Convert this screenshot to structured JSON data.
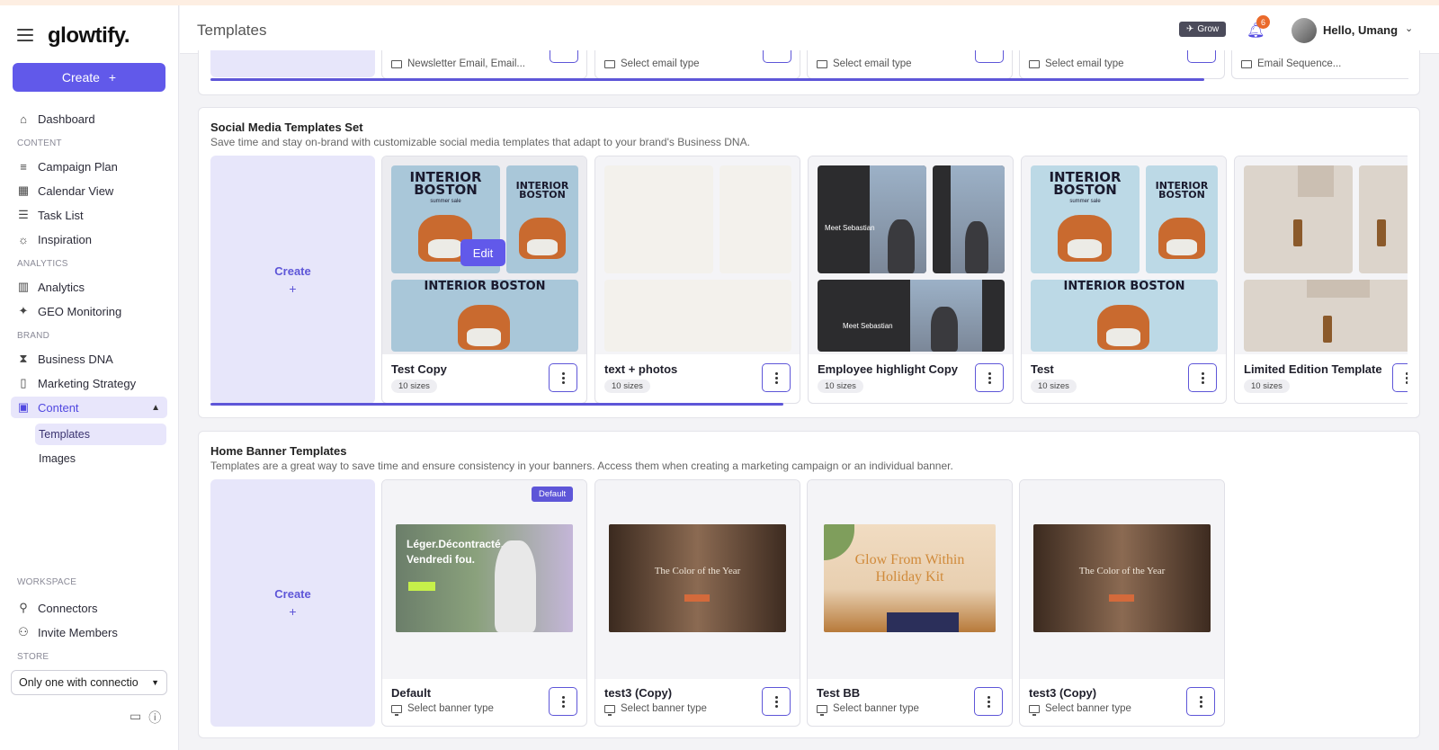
{
  "app": {
    "logo": "glowtify.",
    "page_title": "Templates"
  },
  "sidebar": {
    "create_label": "Create",
    "items": [
      {
        "label": "Dashboard",
        "icon": "home-icon"
      },
      {
        "label": "Campaign Plan",
        "icon": "lines-icon"
      },
      {
        "label": "Calendar View",
        "icon": "calendar-icon"
      },
      {
        "label": "Task List",
        "icon": "list-icon"
      },
      {
        "label": "Inspiration",
        "icon": "bulb-icon"
      },
      {
        "label": "Analytics",
        "icon": "bar-chart-icon"
      },
      {
        "label": "GEO Monitoring",
        "icon": "sparkle-icon"
      },
      {
        "label": "Business DNA",
        "icon": "dna-icon"
      },
      {
        "label": "Marketing Strategy",
        "icon": "book-icon"
      },
      {
        "label": "Content",
        "icon": "image-icon"
      },
      {
        "label": "Connectors",
        "icon": "plug-icon"
      },
      {
        "label": "Invite Members",
        "icon": "user-plus-icon"
      }
    ],
    "sections": {
      "content": "CONTENT",
      "analytics": "ANALYTICS",
      "brand": "BRAND",
      "workspace": "WORKSPACE",
      "store": "STORE"
    },
    "sub_items": [
      "Templates",
      "Images"
    ],
    "store_value": "Only one with connectio"
  },
  "header": {
    "grow_label": "Grow",
    "notification_count": "6",
    "greeting": "Hello, Umang"
  },
  "email_row": {
    "fields": [
      "Newsletter Email, Email...",
      "Select email type",
      "Select email type",
      "Select email type",
      "Email Sequence..."
    ]
  },
  "social": {
    "title": "Social Media Templates Set",
    "description": "Save time and stay on-brand with customizable social media templates that adapt to your brand's Business DNA.",
    "create_label": "Create",
    "create_plus": "+",
    "edit_label": "Edit",
    "cards": [
      {
        "name": "Test Copy",
        "sizes": "10 sizes"
      },
      {
        "name": "text + photos",
        "sizes": "10 sizes"
      },
      {
        "name": "Employee highlight Copy",
        "sizes": "10 sizes"
      },
      {
        "name": "Test",
        "sizes": "10 sizes"
      },
      {
        "name": "Limited Edition Template",
        "sizes": "10 sizes"
      }
    ],
    "thumb_text": {
      "interior": "INTERIOR BOSTON",
      "summer": "summer sale",
      "meet": "Meet Sebastian"
    }
  },
  "banners": {
    "title": "Home Banner Templates",
    "description": "Templates are a great way to save time and ensure consistency in your banners. Access them when creating a marketing campaign or an individual banner.",
    "create_label": "Create",
    "create_plus": "+",
    "default_badge": "Default",
    "cards": [
      {
        "name": "Default",
        "type": "Select banner type",
        "headline": "Léger.Décontracté. Vendredi fou."
      },
      {
        "name": "test3 (Copy)",
        "type": "Select banner type",
        "headline": "The Color of the Year"
      },
      {
        "name": "Test BB",
        "type": "Select banner type",
        "headline": "Glow From Within Holiday Kit"
      },
      {
        "name": "test3 (Copy)",
        "type": "Select banner type",
        "headline": "The Color of the Year"
      }
    ]
  },
  "colors": {
    "accent": "#5e56d8",
    "accent_soft": "#e7e6fa",
    "badge_orange": "#ea6a2b"
  }
}
